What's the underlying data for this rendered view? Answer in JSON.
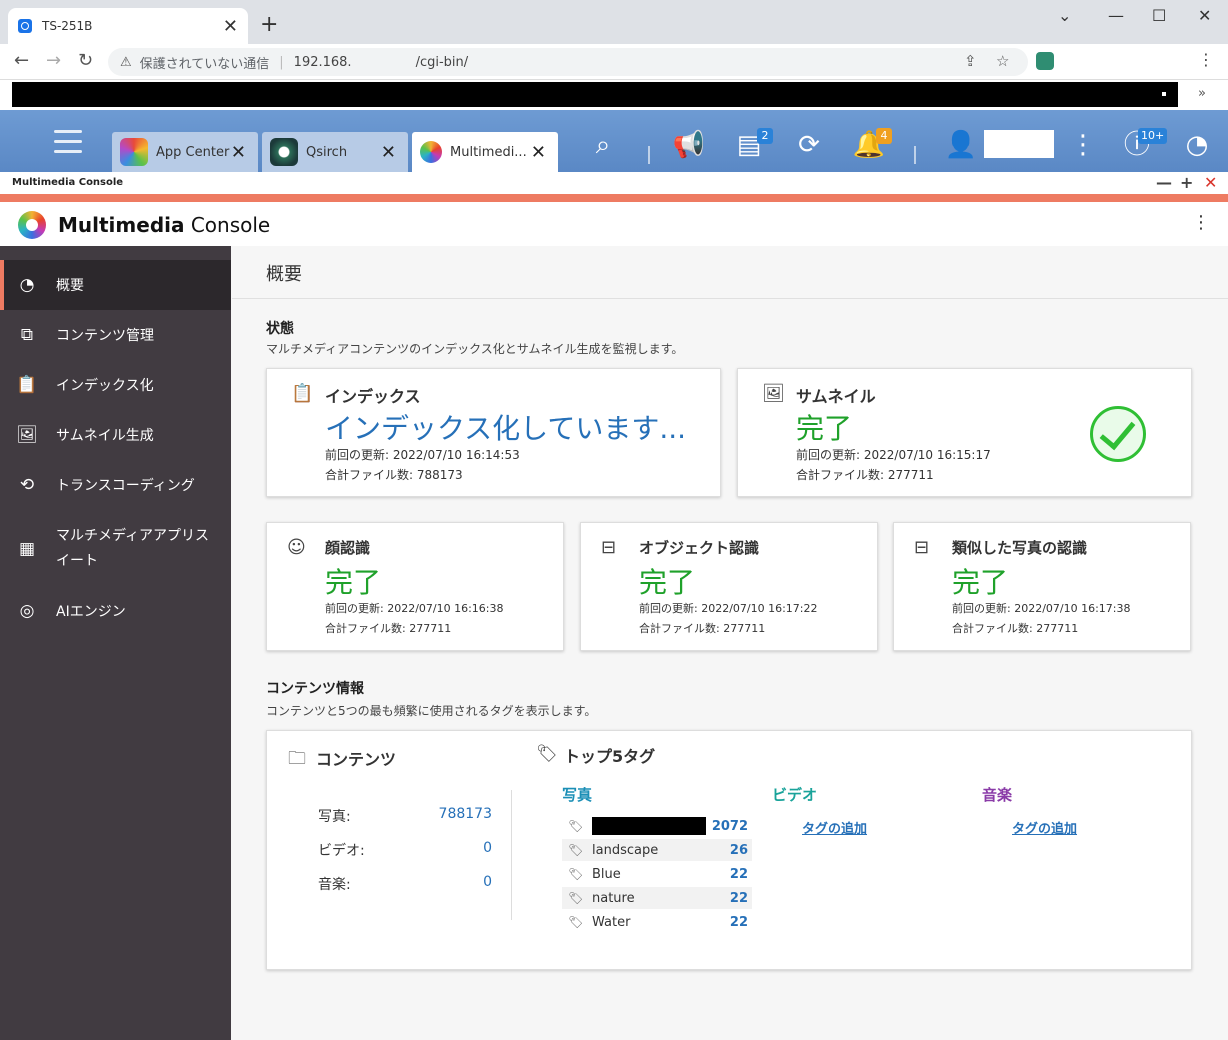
{
  "browser": {
    "tab_title": "TS-251B",
    "security_label": "保護されていない通信",
    "url_host": "192.168.",
    "url_path": "/cgi-bin/"
  },
  "qts": {
    "tabs": [
      {
        "label": "App Center"
      },
      {
        "label": "Qsirch"
      },
      {
        "label": "Multimedi..."
      }
    ],
    "badges": {
      "tasks": "2",
      "notifications": "4",
      "updates": "10+"
    }
  },
  "window": {
    "title": "Multimedia Console"
  },
  "app": {
    "name_bold": "Multimedia",
    "name_rest": " Console"
  },
  "sidebar": {
    "items": [
      {
        "label": "概要"
      },
      {
        "label": "コンテンツ管理"
      },
      {
        "label": "インデックス化"
      },
      {
        "label": "サムネイル生成"
      },
      {
        "label": "トランスコーディング"
      },
      {
        "label": "マルチメディアアプリス"
      },
      {
        "label": "AIエンジン"
      }
    ],
    "item5_line2": "イート"
  },
  "page": {
    "title": "概要"
  },
  "status": {
    "heading": "状態",
    "description": "マルチメディアコンテンツのインデックス化とサムネイル生成を監視します。",
    "indexing": {
      "title": "インデックス",
      "state": "インデックス化しています...",
      "updated": "前回の更新:  2022/07/10 16:14:53",
      "files": "合計ファイル数:  788173"
    },
    "thumbnail": {
      "title": "サムネイル",
      "state": "完了",
      "updated": "前回の更新:  2022/07/10 16:15:17",
      "files": "合計ファイル数:  277711"
    },
    "face": {
      "title": "顔認識",
      "state": "完了",
      "updated": "前回の更新:  2022/07/10 16:16:38",
      "files": "合計ファイル数:  277711"
    },
    "object": {
      "title": "オブジェクト認識",
      "state": "完了",
      "updated": "前回の更新:  2022/07/10 16:17:22",
      "files": "合計ファイル数:  277711"
    },
    "similar": {
      "title": "類似した写真の認識",
      "state": "完了",
      "updated": "前回の更新:  2022/07/10 16:17:38",
      "files": "合計ファイル数:  277711"
    }
  },
  "content_info": {
    "heading": "コンテンツ情報",
    "description": "コンテンツと5つの最も頻繁に使用されるタグを表示します。",
    "contents_title": "コンテンツ",
    "counts": [
      {
        "label": "写真:",
        "value": "788173"
      },
      {
        "label": "ビデオ:",
        "value": "0"
      },
      {
        "label": "音楽:",
        "value": "0"
      }
    ],
    "tags_title": "トップ5タグ",
    "photo_label": "写真",
    "video_label": "ビデオ",
    "music_label": "音楽",
    "photo_tags": [
      {
        "name": "",
        "count": "2072"
      },
      {
        "name": "landscape",
        "count": "26"
      },
      {
        "name": "Blue",
        "count": "22"
      },
      {
        "name": "nature",
        "count": "22"
      },
      {
        "name": "Water",
        "count": "22"
      }
    ],
    "add_tag": "タグの追加"
  },
  "colors": {
    "accent": "#ee7b62",
    "sidebar": "#413b41",
    "link": "#2670b8",
    "success": "#1fa12a"
  }
}
